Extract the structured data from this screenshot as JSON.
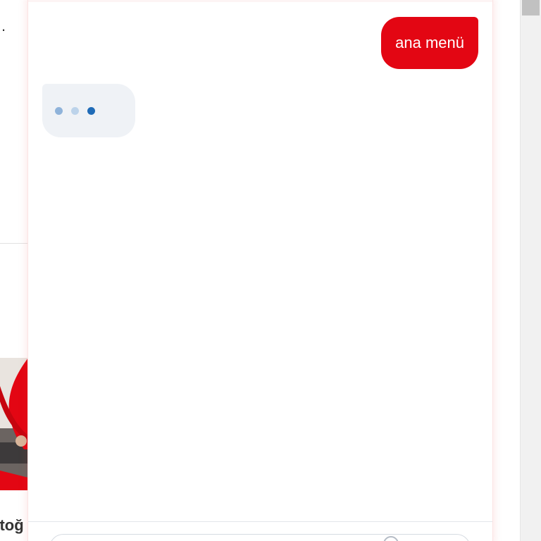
{
  "background_page": {
    "visible_dot": ".",
    "caption_fragment": "otoğ"
  },
  "chat": {
    "messages": [
      {
        "role": "user",
        "text": "ana menü"
      }
    ],
    "typing_indicator": {
      "dots": [
        {
          "color": "#8fb3da"
        },
        {
          "color": "#bcd3ea"
        },
        {
          "color": "#1f6bb7"
        }
      ]
    }
  },
  "colors": {
    "brand_red": "#e30613",
    "bot_bubble": "#eff2f6",
    "typing_active": "#1f6bb7"
  }
}
